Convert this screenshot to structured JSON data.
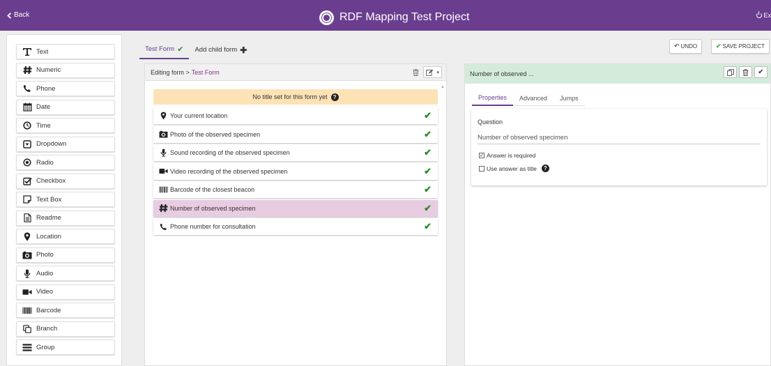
{
  "topbar": {
    "back_label": "Back",
    "app_title": "RDF Mapping Test Project",
    "exit_label": "Ex",
    "color": "#6a3d8f"
  },
  "palette": {
    "items": [
      {
        "label": "Text",
        "icon": "text-t-icon"
      },
      {
        "label": "Numeric",
        "icon": "hash-icon"
      },
      {
        "label": "Phone",
        "icon": "phone-icon"
      },
      {
        "label": "Date",
        "icon": "calendar-icon"
      },
      {
        "label": "Time",
        "icon": "clock-icon"
      },
      {
        "label": "Dropdown",
        "icon": "dropdown-icon"
      },
      {
        "label": "Radio",
        "icon": "radio-icon"
      },
      {
        "label": "Checkbox",
        "icon": "checkbox-icon"
      },
      {
        "label": "Text Box",
        "icon": "textbox-icon"
      },
      {
        "label": "Readme",
        "icon": "document-icon"
      },
      {
        "label": "Location",
        "icon": "map-marker-icon"
      },
      {
        "label": "Photo",
        "icon": "camera-icon"
      },
      {
        "label": "Audio",
        "icon": "microphone-icon"
      },
      {
        "label": "Video",
        "icon": "video-camera-icon"
      },
      {
        "label": "Barcode",
        "icon": "barcode-icon"
      },
      {
        "label": "Branch",
        "icon": "branch-icon"
      },
      {
        "label": "Group",
        "icon": "group-icon"
      }
    ]
  },
  "form_tabs": {
    "active_label": "Test Form",
    "add_child_label": "Add child form"
  },
  "center": {
    "crumb_prefix": "Editing form >",
    "crumb_form": "Test Form",
    "no_title_notice": "No title set for this form yet",
    "questions": [
      {
        "label": "Your current location",
        "icon": "map-marker-icon"
      },
      {
        "label": "Photo of the observed specimen",
        "icon": "camera-icon"
      },
      {
        "label": "Sound recording of the observed specimen",
        "icon": "microphone-icon"
      },
      {
        "label": "Video recording of the observed specimen",
        "icon": "video-camera-icon"
      },
      {
        "label": "Barcode of the closest beacon",
        "icon": "barcode-icon"
      },
      {
        "label": "Number of observed specimen",
        "icon": "hash-icon",
        "selected": true
      },
      {
        "label": "Phone number for consultation",
        "icon": "phone-icon"
      }
    ]
  },
  "actions": {
    "undo_label": "UNDO",
    "save_label": "SAVE PROJECT"
  },
  "detail": {
    "header_title": "Number of observed ...",
    "tabs": [
      "Properties",
      "Advanced",
      "Jumps"
    ],
    "question_label": "Question",
    "question_value": "Number of observed specimen",
    "required_label": "Answer is required",
    "required_checked": true,
    "use_as_title_label": "Use answer as title",
    "use_as_title_checked": false
  }
}
